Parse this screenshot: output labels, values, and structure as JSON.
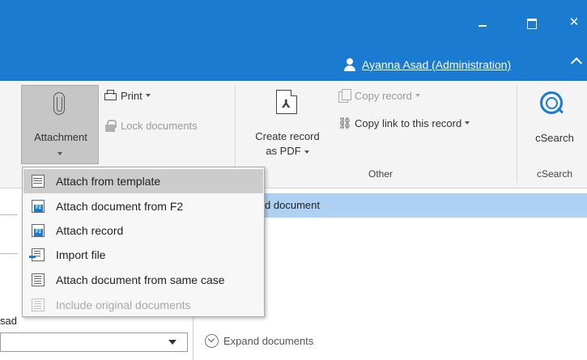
{
  "window": {
    "minimize_glyph": "",
    "maximize_glyph": "",
    "close_glyph": "✕",
    "user_name": "Ayanna Asad (Administration)"
  },
  "ribbon": {
    "attachment_label": "Attachment",
    "print_label": "Print",
    "lock_label": "Lock documents",
    "create_pdf_label_line1": "Create record",
    "create_pdf_label_line2": "as PDF",
    "copy_record_label": "Copy record",
    "copy_link_label": "Copy link to this record",
    "csearch_label": "cSearch",
    "group_other": "Other",
    "group_csearch": "cSearch"
  },
  "dropdown": {
    "items": [
      {
        "label": "Attach from template",
        "icon": "template-icon",
        "disabled": false
      },
      {
        "label": "Attach document from F2",
        "icon": "f2-document-icon",
        "disabled": false
      },
      {
        "label": "Attach record",
        "icon": "f2-record-icon",
        "disabled": false
      },
      {
        "label": "Import file",
        "icon": "import-file-icon",
        "disabled": false
      },
      {
        "label": "Attach document from same case",
        "icon": "same-case-icon",
        "disabled": false
      },
      {
        "label": "Include original documents",
        "icon": "original-documents-icon",
        "disabled": true
      }
    ]
  },
  "content": {
    "selected_row_text": "cord document",
    "partial_left_text": "sad",
    "expand_label": "Expand documents"
  },
  "colors": {
    "title_bar": "#1a7bd1",
    "selection": "#aed0f2",
    "hover": "#cccccc"
  }
}
